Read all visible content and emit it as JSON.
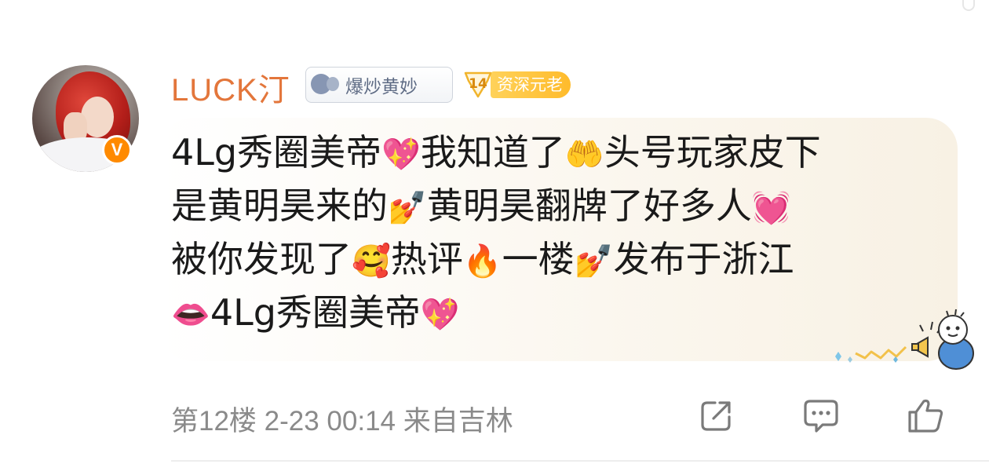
{
  "user": {
    "name": "LUCK汀",
    "verified_badge": "V",
    "fan_tag": "爆炒黄妙",
    "level_number": "14",
    "level_label": "资深元老"
  },
  "comment": {
    "lines": [
      [
        "4Lg秀圈美帝",
        "💖",
        "我知道了",
        "🤲",
        "头号玩家皮下"
      ],
      [
        "是黄明昊来的",
        "💅",
        "黄明昊翻牌了好多人",
        "💓"
      ],
      [
        "被你发现了",
        "🥰",
        "热评",
        "🔥",
        "一楼",
        "💅",
        "发布于浙江"
      ],
      [
        "👄",
        "4Lg秀圈美帝",
        "💖"
      ]
    ]
  },
  "footer": {
    "meta": "第12楼  2-23 00:14  来自吉林",
    "actions": [
      "share",
      "comment",
      "like"
    ]
  },
  "colors": {
    "username": "#e3763b",
    "meta_text": "#8a8a8a",
    "level_pill": "#ffc23a",
    "verified": "#ff8a00"
  }
}
